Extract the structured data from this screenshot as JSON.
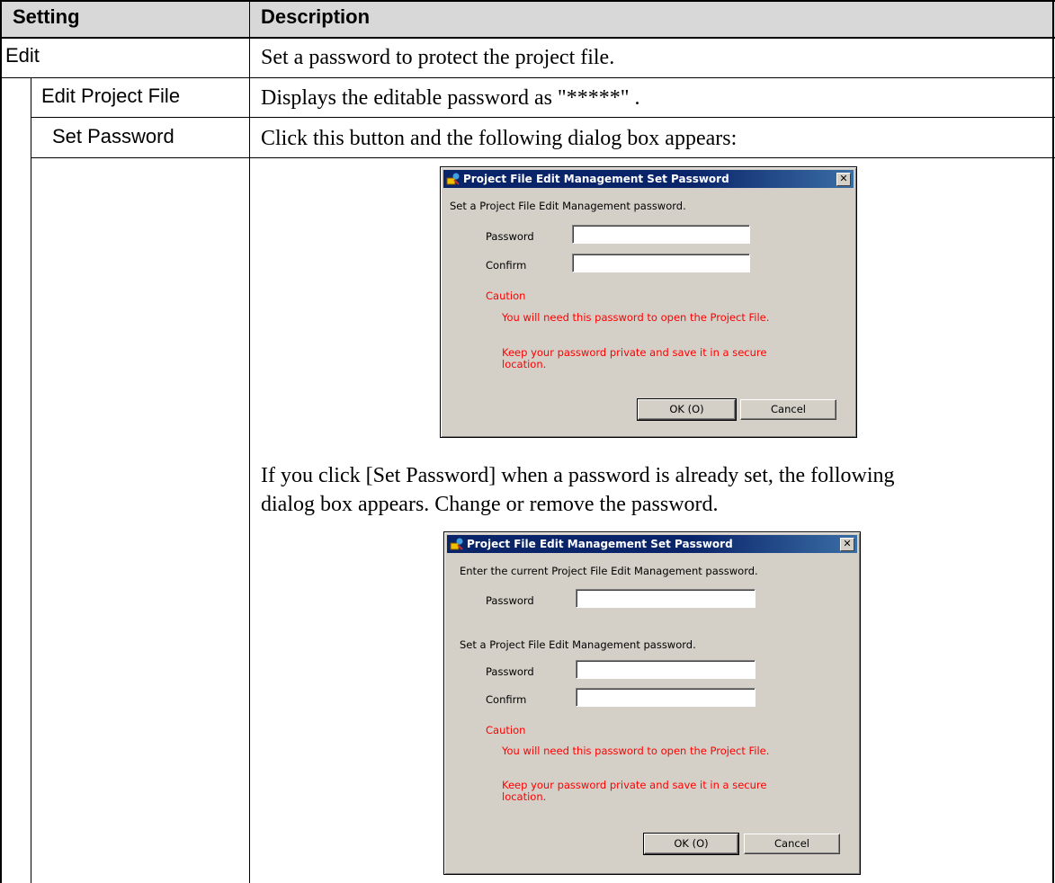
{
  "header": {
    "col_setting": "Setting",
    "col_description": "Description"
  },
  "rows": {
    "edit": {
      "setting": "Edit",
      "description": "Set a password to protect the project file."
    },
    "edit_project_file": {
      "setting": "Edit Project File",
      "description": "Displays the editable password as \"*****\" ."
    },
    "set_password": {
      "setting": "Set Password",
      "description_1": "Click this button and the following dialog box appears:",
      "description_2a": "If you click [Set Password] when a password is already set, the following",
      "description_2b": "dialog box appears. Change or remove the password."
    }
  },
  "dialog1": {
    "title": "Project File Edit Management Set Password",
    "close_glyph": "✕",
    "prompt": "Set a Project File Edit Management  password.",
    "password_label": "Password",
    "confirm_label": "Confirm",
    "caution_label": "Caution",
    "caution_line1": "You will need this password to open the Project File.",
    "caution_line2": "Keep your password private and save it in a secure",
    "caution_line3": "location.",
    "ok_label": "OK (O)",
    "cancel_label": "Cancel"
  },
  "dialog2": {
    "title": "Project File Edit Management Set Password",
    "close_glyph": "✕",
    "current_prompt": "Enter the current Project File Edit Management  password.",
    "current_password_label": "Password",
    "prompt": "Set a Project File Edit Management  password.",
    "password_label": "Password",
    "confirm_label": "Confirm",
    "caution_label": "Caution",
    "caution_line1": "You will need this password to open the Project File.",
    "caution_line2": "Keep your password private and save it in a secure",
    "caution_line3": "location.",
    "ok_label": "OK (O)",
    "cancel_label": "Cancel"
  },
  "colors": {
    "header_bg": "#d8d8d8",
    "dialog_face": "#d4d0c8",
    "title_bar": "#0a246a",
    "caution_text": "#ff0000"
  },
  "icons": {
    "dialog_icon": "app-icon",
    "close": "close-icon"
  }
}
